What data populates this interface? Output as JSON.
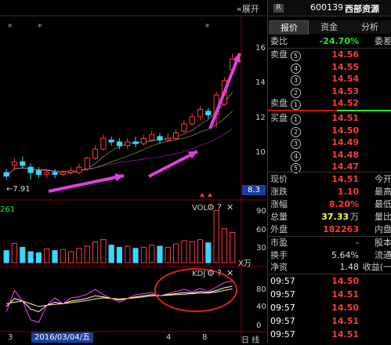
{
  "header": {
    "expand_label": "«展开",
    "badge": "R",
    "stock_code": "600139",
    "stock_name": "西部资源"
  },
  "tabs": [
    {
      "label": "报价"
    },
    {
      "label": "资金"
    },
    {
      "label": "分析"
    }
  ],
  "order_book": {
    "weibi_label": "委比",
    "weibi_value": "-24.70%",
    "weicha_label": "委差",
    "sell": [
      {
        "label": "卖盘",
        "num": "5",
        "price": "14.56"
      },
      {
        "label": "",
        "num": "4",
        "price": "14.55"
      },
      {
        "label": "",
        "num": "3",
        "price": "14.54"
      },
      {
        "label": "",
        "num": "2",
        "price": "14.53"
      },
      {
        "label": "卖盘",
        "num": "1",
        "price": "14.52"
      }
    ],
    "buy": [
      {
        "label": "买盘",
        "num": "1",
        "price": "14.51"
      },
      {
        "label": "",
        "num": "2",
        "price": "14.50"
      },
      {
        "label": "",
        "num": "3",
        "price": "14.49"
      },
      {
        "label": "",
        "num": "4",
        "price": "14.48"
      },
      {
        "label": "",
        "num": "5",
        "price": "14.47"
      }
    ]
  },
  "quote": {
    "current_label": "现价",
    "current_value": "14.51",
    "open_label": "今开",
    "change_label": "涨跌",
    "change_value": "1.10",
    "high_label": "最高",
    "pct_label": "涨幅",
    "pct_value": "8.20%",
    "low_label": "最低",
    "total_label": "总量",
    "total_value": "37.33",
    "total_unit": "万",
    "amount_label": "量比",
    "outer_label": "外盘",
    "outer_value": "182263",
    "inner_label": "内盘",
    "pe_label": "市盈",
    "pe_value": "-",
    "equity_label": "股本",
    "turnover_label": "换手",
    "turnover_value": "5.64%",
    "float_label": "流通",
    "nav_label": "净资",
    "nav_value": "1.48",
    "income_label": "收益(一"
  },
  "ticks": [
    {
      "time": "09:57",
      "price": "14.50",
      "color": "#ff3b3b"
    },
    {
      "time": "09:57",
      "price": "14.51",
      "color": "#ff3b3b"
    },
    {
      "time": "09:57",
      "price": "14.50",
      "color": "#ff3b3b"
    },
    {
      "time": "09:57",
      "price": "14.51",
      "color": "#ff3b3b"
    },
    {
      "time": "09:57",
      "price": "14.51",
      "color": "#ff3b3b"
    }
  ],
  "chart": {
    "price_axis": [
      "16",
      "14",
      "12",
      "10"
    ],
    "current_price_tag": "8.3",
    "low_annotation": "←7.91",
    "vol_label": "VOL",
    "vol_axis": [
      "90",
      "60",
      "30",
      "X万"
    ],
    "vol_left_value": "261",
    "kdj_label": "KDJ",
    "kdj_axis": [
      "80",
      "40",
      "0"
    ],
    "date_label": "2016/03/04/五",
    "date_ticks": [
      "3",
      "4",
      "8"
    ],
    "bottom_right": "日 线"
  },
  "chart_data": {
    "type": "candlestick",
    "title": "",
    "ylim": [
      7,
      17
    ],
    "candles": [
      {
        "o": 8.3,
        "c": 8.1,
        "h": 8.5,
        "l": 7.9
      },
      {
        "o": 8.7,
        "c": 8.9,
        "h": 9.1,
        "l": 8.5
      },
      {
        "o": 8.9,
        "c": 8.7,
        "h": 9.2,
        "l": 8.5
      },
      {
        "o": 8.6,
        "c": 8.3,
        "h": 8.8,
        "l": 7.91
      },
      {
        "o": 8.4,
        "c": 8.2,
        "h": 8.6,
        "l": 8.0
      },
      {
        "o": 8.2,
        "c": 8.3,
        "h": 8.5,
        "l": 8.0
      },
      {
        "o": 8.3,
        "c": 8.2,
        "h": 8.5,
        "l": 8.0
      },
      {
        "o": 8.2,
        "c": 8.3,
        "h": 8.4,
        "l": 8.1
      },
      {
        "o": 8.3,
        "c": 8.4,
        "h": 8.6,
        "l": 8.2
      },
      {
        "o": 8.3,
        "c": 8.6,
        "h": 8.8,
        "l": 8.2
      },
      {
        "o": 8.5,
        "c": 9.1,
        "h": 9.2,
        "l": 8.4
      },
      {
        "o": 9.1,
        "c": 9.6,
        "h": 9.8,
        "l": 9.0
      },
      {
        "o": 9.6,
        "c": 10.2,
        "h": 10.4,
        "l": 9.5
      },
      {
        "o": 10.1,
        "c": 10.0,
        "h": 10.3,
        "l": 9.8
      },
      {
        "o": 10.0,
        "c": 9.8,
        "h": 10.2,
        "l": 9.6
      },
      {
        "o": 9.8,
        "c": 10.0,
        "h": 10.2,
        "l": 9.6
      },
      {
        "o": 10.0,
        "c": 9.9,
        "h": 10.3,
        "l": 9.7
      },
      {
        "o": 9.9,
        "c": 10.2,
        "h": 10.4,
        "l": 9.8
      },
      {
        "o": 10.1,
        "c": 10.4,
        "h": 10.6,
        "l": 10.0
      },
      {
        "o": 10.3,
        "c": 10.1,
        "h": 10.5,
        "l": 9.9
      },
      {
        "o": 10.1,
        "c": 10.2,
        "h": 10.5,
        "l": 10.0
      },
      {
        "o": 10.2,
        "c": 10.5,
        "h": 10.7,
        "l": 10.1
      },
      {
        "o": 10.6,
        "c": 11.0,
        "h": 11.2,
        "l": 10.5
      },
      {
        "o": 11.0,
        "c": 11.4,
        "h": 11.6,
        "l": 10.9
      },
      {
        "o": 11.4,
        "c": 11.8,
        "h": 12.0,
        "l": 11.2
      },
      {
        "o": 11.7,
        "c": 11.5,
        "h": 11.9,
        "l": 11.3
      },
      {
        "o": 11.5,
        "c": 12.6,
        "h": 12.8,
        "l": 10.8
      },
      {
        "o": 12.1,
        "c": 13.4,
        "h": 13.6,
        "l": 12.0
      },
      {
        "o": 14.0,
        "c": 14.6,
        "h": 14.9,
        "l": 13.8
      }
    ],
    "volume": [
      22,
      35,
      28,
      20,
      18,
      25,
      22,
      24,
      20,
      26,
      30,
      38,
      42,
      32,
      28,
      30,
      26,
      28,
      32,
      30,
      28,
      34,
      40,
      38,
      42,
      36,
      95,
      62,
      55
    ],
    "kdj": {
      "K": [
        40,
        55,
        50,
        35,
        30,
        42,
        48,
        45,
        50,
        52,
        55,
        60,
        58,
        55,
        52,
        55,
        58,
        60,
        62,
        60,
        62,
        64,
        66,
        65,
        68,
        66,
        70,
        75,
        78
      ],
      "D": [
        45,
        48,
        50,
        45,
        40,
        42,
        44,
        45,
        47,
        49,
        51,
        54,
        56,
        55,
        54,
        55,
        56,
        58,
        60,
        60,
        61,
        62,
        63,
        64,
        65,
        65,
        67,
        70,
        73
      ],
      "J": [
        30,
        70,
        50,
        15,
        10,
        42,
        56,
        45,
        56,
        58,
        63,
        72,
        62,
        55,
        48,
        55,
        62,
        64,
        66,
        60,
        64,
        68,
        72,
        67,
        74,
        68,
        76,
        85,
        88
      ]
    }
  }
}
